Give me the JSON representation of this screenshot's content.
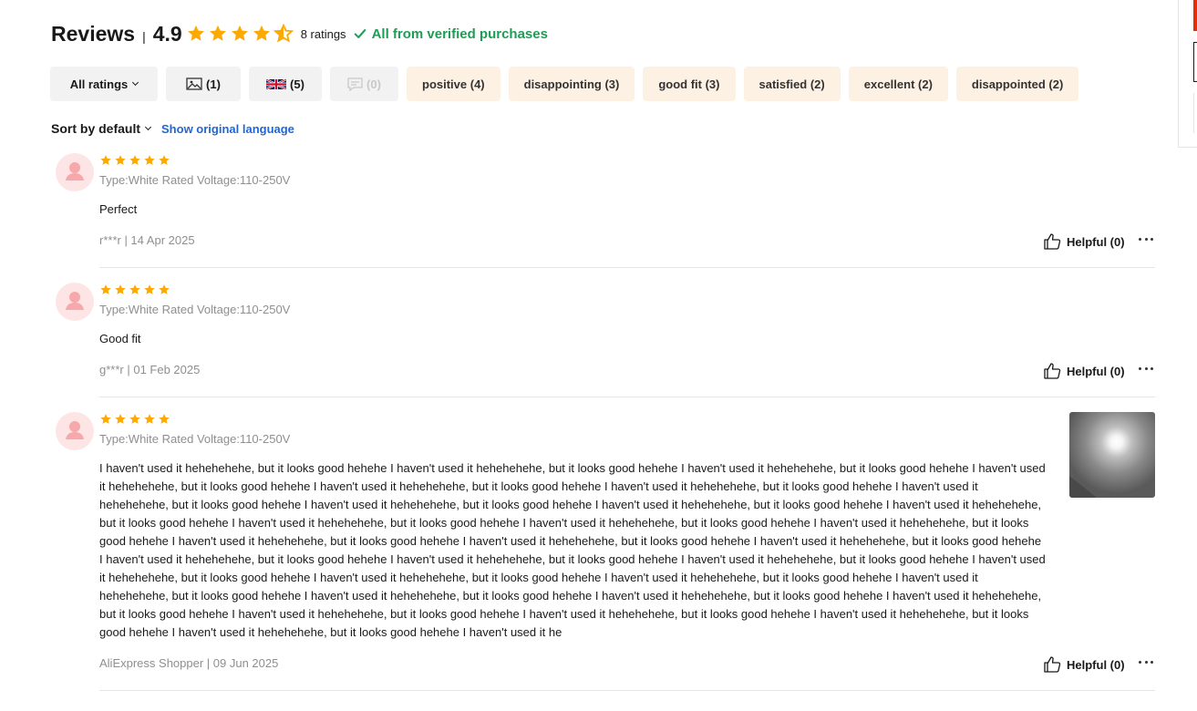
{
  "header": {
    "title": "Reviews",
    "separator": "|",
    "score": "4.9",
    "rating_stars": 4.5,
    "count": "8 ratings",
    "verified": "All from verified purchases"
  },
  "filters": [
    {
      "label": "All ratings",
      "icon": "caret-down-icon"
    },
    {
      "label": "(1)",
      "icon": "image-icon"
    },
    {
      "label": "(5)",
      "icon": "uk-flag-icon"
    },
    {
      "label": "(0)",
      "icon": "comment-icon"
    },
    {
      "label": "positive (4)"
    },
    {
      "label": "disappointing (3)"
    },
    {
      "label": "good fit (3)"
    },
    {
      "label": "satisfied (2)"
    },
    {
      "label": "excellent (2)"
    },
    {
      "label": "disappointed (2)"
    }
  ],
  "sort": {
    "label": "Sort by default",
    "show_original": "Show original language"
  },
  "reviews": [
    {
      "stars": 5,
      "type": "Type:White Rated Voltage:110-250V",
      "text": "Perfect",
      "meta": "r***r | 14 Apr 2025",
      "helpful": "Helpful (0)"
    },
    {
      "stars": 5,
      "type": "Type:White Rated Voltage:110-250V",
      "text": "Good fit",
      "meta": "g***r | 01 Feb 2025",
      "helpful": "Helpful (0)"
    },
    {
      "stars": 5,
      "type": "Type:White Rated Voltage:110-250V",
      "text": "I haven't used it hehehehehe, but it looks good hehehe I haven't used it hehehehehe, but it looks good hehehe I haven't used it hehehehehe, but it looks good hehehe I haven't used it hehehehehe, but it looks good hehehe I haven't used it hehehehehe, but it looks good hehehe I haven't used it hehehehehe, but it looks good hehehe I haven't used it hehehehehe, but it looks good hehehe I haven't used it hehehehehe, but it looks good hehehe I haven't used it hehehehehe, but it looks good hehehe I haven't used it hehehehehe, but it looks good hehehe I haven't used it hehehehehe, but it looks good hehehe I haven't used it hehehehehe, but it looks good hehehe I haven't used it hehehehehe, but it looks good hehehe I haven't used it hehehehehe, but it looks good hehehe I haven't used it hehehehehe, but it looks good hehehe I haven't used it hehehehehe, but it looks good hehehe I haven't used it hehehehehe, but it looks good hehehe I haven't used it hehehehehe, but it looks good hehehe I haven't used it hehehehehe, but it looks good hehehe I haven't used it hehehehehe, but it looks good hehehe I haven't used it hehehehehe, but it looks good hehehe I haven't used it hehehehehe, but it looks good hehehe I haven't used it hehehehehe, but it looks good hehehe I haven't used it hehehehehe, but it looks good hehehe I haven't used it hehehehehe, but it looks good hehehe I haven't used it hehehehehe, but it looks good hehehe I haven't used it hehehehehe, but it looks good hehehe I haven't used it hehehehehe, but it looks good hehehe I haven't used it hehehehehe, but it looks good hehehe I haven't used it hehehehehe, but it looks good hehehe I haven't used it he",
      "meta": "AliExpress Shopper | 09 Jun 2025",
      "helpful": "Helpful (0)",
      "has_photo": true
    }
  ],
  "colors": {
    "star": "#fea902",
    "verified": "#1e9d55",
    "link": "#2167d4",
    "chip_grey": "#f2f2f2",
    "chip_beige": "#fdf1e3"
  }
}
